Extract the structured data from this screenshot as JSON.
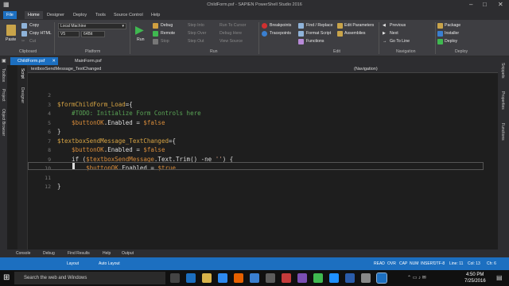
{
  "window": {
    "title": "ChildForm.psf - SAPIEN PowerShell Studio 2016"
  },
  "ribbon_tabs": [
    {
      "label": "File"
    },
    {
      "label": "Home"
    },
    {
      "label": "Designer"
    },
    {
      "label": "Deploy"
    },
    {
      "label": "Tools"
    },
    {
      "label": "Source Control"
    },
    {
      "label": "Help"
    }
  ],
  "clipboard": {
    "paste": "Paste",
    "copy": "Copy",
    "copy_html": "Copy HTML",
    "cut": "Cut",
    "group": "Clipboard"
  },
  "platform": {
    "machine": "Local Machine",
    "version": "V5",
    "arch": "64Bit",
    "group": "Platform"
  },
  "run": {
    "run": "Run",
    "debug": "Debug",
    "remote": "Remote",
    "stop": "Stop",
    "step_into": "Step Into",
    "step_over": "Step Over",
    "step_out": "Step Out",
    "run_to_cursor": "Run To Cursor",
    "debug_here": "Debug Here",
    "view_source": "View Source",
    "group": "Run"
  },
  "edit": {
    "breakpoints": "Breakpoints",
    "tracepoints": "Tracepoints",
    "find_replace": "Find / Replace",
    "format_script": "Format Script",
    "functions": "Functions",
    "edit_parameters": "Edit Parameters",
    "assemblies": "Assemblies",
    "group": "Edit"
  },
  "navigation": {
    "previous": "Previous",
    "next": "Next",
    "go_to_line": "Go To Line",
    "group": "Navigation"
  },
  "deploy": {
    "package": "Package",
    "installer": "Installer",
    "deploy": "Deploy",
    "group": "Deploy"
  },
  "doc_tabs": [
    {
      "label": "ChildForm.psf"
    },
    {
      "label": "MainForm.psf"
    }
  ],
  "sidebar_left": {
    "toolbox": "Toolbox",
    "project": "Project",
    "object_browser": "Object Browser",
    "designer": "Designer",
    "script": "Script"
  },
  "sidebar_right": {
    "snippets": "Snippets",
    "properties": "Properties",
    "functions": "Functions"
  },
  "nav_bar": {
    "left": "textboxSendMessage_TextChanged",
    "right": "(Navigation)"
  },
  "code": {
    "line_numbers": [
      "2",
      "3",
      "4",
      "5",
      "6",
      "7",
      "8",
      "9",
      "10",
      "11",
      "12"
    ],
    "lines": [
      {
        "parts": []
      },
      {
        "parts": [
          {
            "c": "fn",
            "t": "$formChildForm_Load"
          },
          {
            "c": "kw",
            "t": "={"
          }
        ]
      },
      {
        "parts": [
          {
            "c": "cm",
            "t": "    #TODO: Initialize Form Controls here"
          }
        ]
      },
      {
        "parts": [
          {
            "c": "var",
            "t": "    $buttonOK"
          },
          {
            "c": "kw",
            "t": ".Enabled = "
          },
          {
            "c": "var",
            "t": "$false"
          }
        ]
      },
      {
        "parts": [
          {
            "c": "kw",
            "t": "}"
          }
        ]
      },
      {
        "parts": [
          {
            "c": "fn",
            "t": "$textboxSendMessage_TextChanged"
          },
          {
            "c": "kw",
            "t": "={"
          }
        ]
      },
      {
        "parts": [
          {
            "c": "var",
            "t": "    $buttonOK"
          },
          {
            "c": "kw",
            "t": ".Enabled = "
          },
          {
            "c": "var",
            "t": "$false"
          }
        ]
      },
      {
        "parts": [
          {
            "c": "kw",
            "t": "    if ("
          },
          {
            "c": "var",
            "t": "$textboxSendMessage"
          },
          {
            "c": "kw",
            "t": ".Text.Trim() -ne "
          },
          {
            "c": "str",
            "t": "''"
          },
          {
            "c": "kw",
            "t": ") {"
          }
        ]
      },
      {
        "parts": [
          {
            "c": "var",
            "t": "        $buttonOK"
          },
          {
            "c": "kw",
            "t": ".Enabled = "
          },
          {
            "c": "var",
            "t": "$true"
          }
        ]
      },
      {
        "parts": []
      },
      {
        "parts": [
          {
            "c": "kw",
            "t": "}"
          }
        ]
      }
    ]
  },
  "bottom_tabs": [
    "Console",
    "Debug",
    "Find Results",
    "Help",
    "Output"
  ],
  "status": {
    "layout": "Layout",
    "auto_layout": "Auto Layout",
    "read": "READ",
    "ovr": "OVR",
    "cap": "CAP",
    "num": "NUM",
    "insert": "INSERT",
    "encoding": "UTF-8",
    "line": "Line: 11",
    "col": "Col: 13",
    "ch": "Ch: 6"
  },
  "taskbar": {
    "search": "Search the web and Windows",
    "time": "4:50 PM",
    "date": "7/25/2016"
  },
  "colors": {
    "accent": "#1c6fc0",
    "editor_bg": "#1e1e1e",
    "ribbon_bg": "#3e3e42"
  }
}
